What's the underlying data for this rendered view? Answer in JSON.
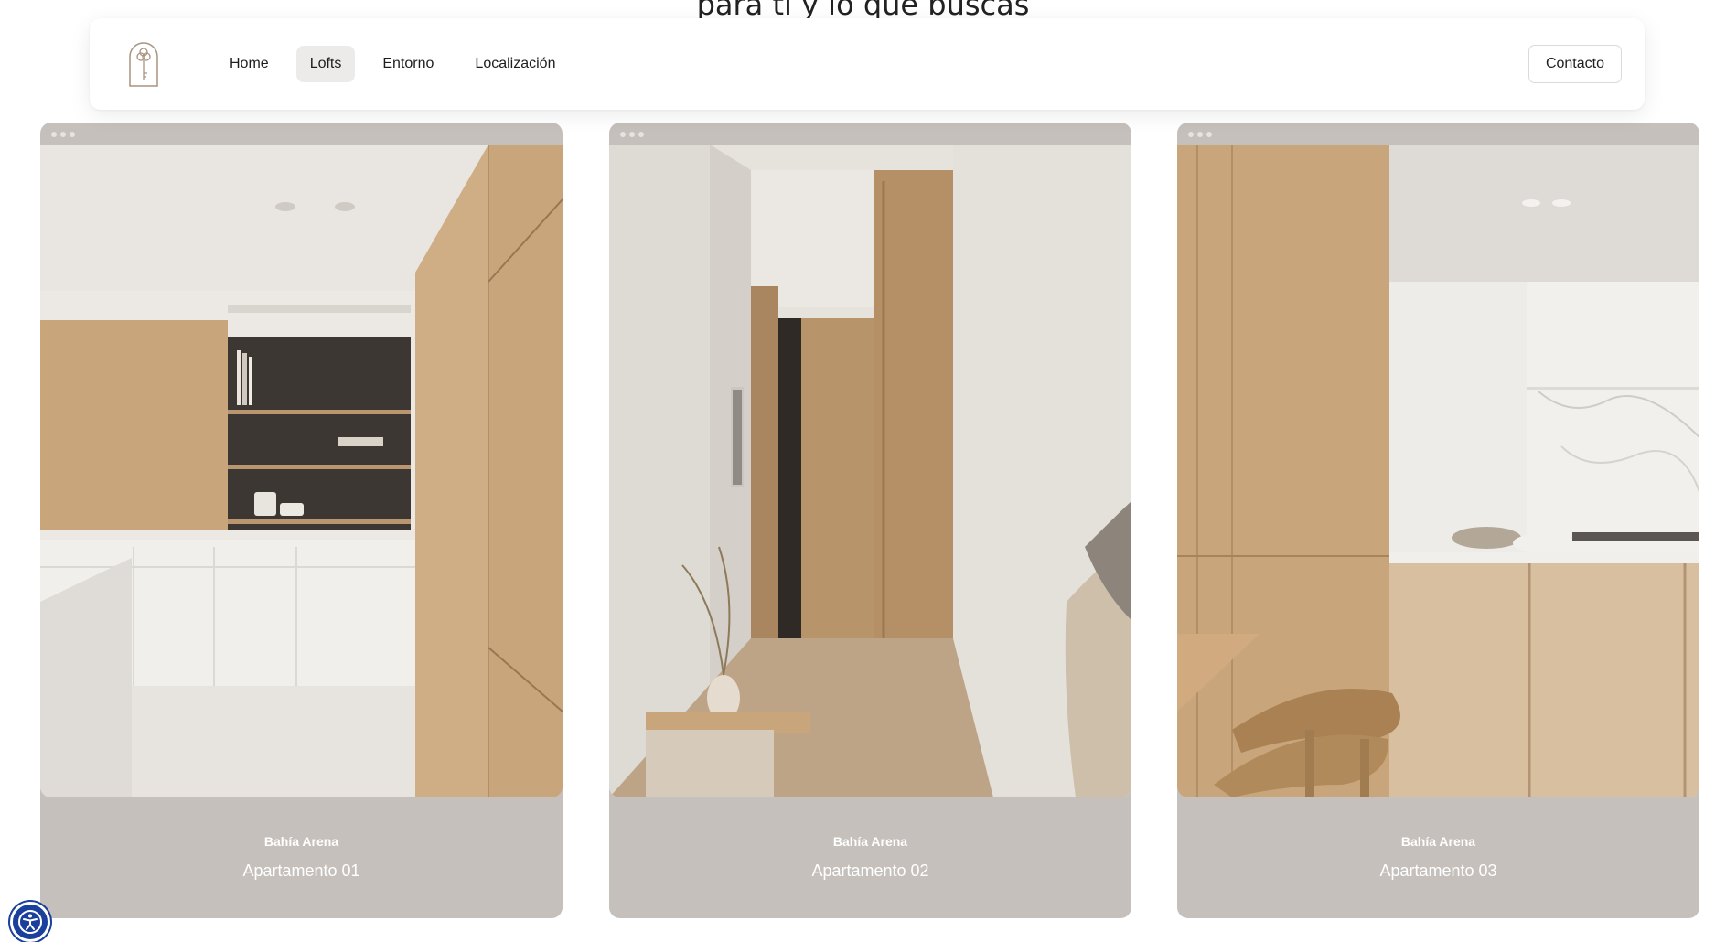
{
  "hero": {
    "partial_heading": "para ti y lo que buscas"
  },
  "nav": {
    "logo": "key-logo",
    "items": [
      {
        "label": "Home",
        "active": false
      },
      {
        "label": "Lofts",
        "active": true
      },
      {
        "label": "Entorno",
        "active": false
      },
      {
        "label": "Localización",
        "active": false
      }
    ],
    "contact_label": "Contacto"
  },
  "cards": [
    {
      "subtitle": "Bahía Arena",
      "title": "Apartamento 01",
      "image": "interior-shelves-photo"
    },
    {
      "subtitle": "Bahía Arena",
      "title": "Apartamento 02",
      "image": "interior-hallway-photo"
    },
    {
      "subtitle": "Bahía Arena",
      "title": "Apartamento 03",
      "image": "interior-kitchen-photo"
    }
  ],
  "colors": {
    "card_bg": "#c5c0bc",
    "active_tab_bg": "#ecebea",
    "wood": "#c9a882",
    "accessibility_blue": "#1a3f9c"
  },
  "accessibility": {
    "icon": "accessibility-icon"
  }
}
